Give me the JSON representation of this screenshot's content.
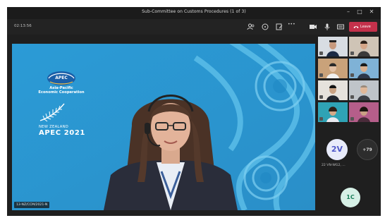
{
  "window": {
    "title": "Sub-Committee on Customs Procedures (1 of 3)",
    "minimize_glyph": "–",
    "maximize_glyph": "□",
    "close_glyph": "✕"
  },
  "toolbar": {
    "timer": "02:13:56",
    "icons": [
      "participants-icon",
      "chat-icon",
      "share-icon",
      "more-icon",
      "camera-icon",
      "mic-icon",
      "share-tray-icon"
    ],
    "more_glyph": "•••",
    "leave_label": "Leave",
    "leave_color": "#c4314b"
  },
  "stage": {
    "background_color": "#2f9dd6",
    "apec_logo_text": "APEC",
    "org_line1": "Asia-Pacific",
    "org_line2": "Economic Cooperation",
    "host_country": "NEW ZEALAND",
    "event": "APEC 2021",
    "speaker_caption": "13-NZ/CCM/2021-N"
  },
  "panel": {
    "avatars": [
      {
        "initials": "2V",
        "name": "22 VN-WG2, ..."
      },
      {
        "initials": "+79"
      },
      {
        "initials": "1C"
      }
    ]
  }
}
